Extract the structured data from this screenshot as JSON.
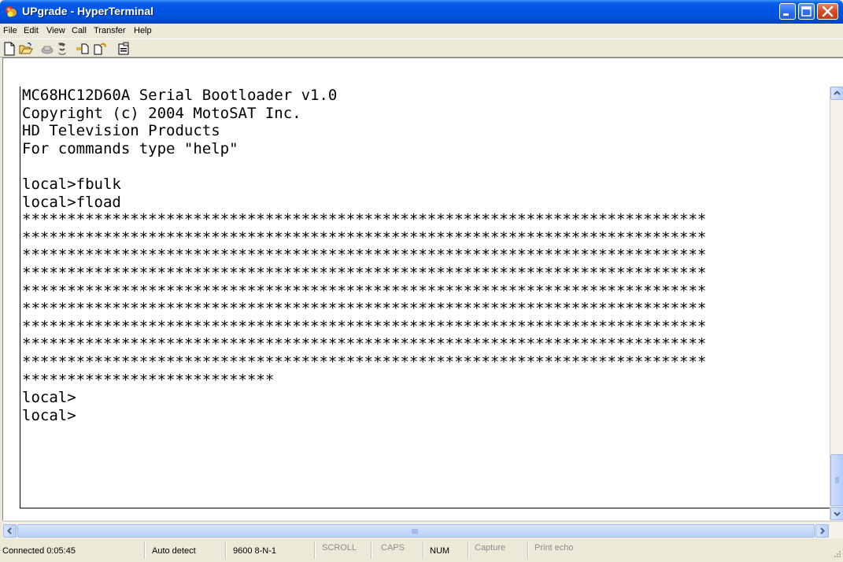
{
  "window": {
    "title": "UPgrade - HyperTerminal"
  },
  "menu": {
    "items": [
      "File",
      "Edit",
      "View",
      "Call",
      "Transfer",
      "Help"
    ]
  },
  "toolbar": {
    "icons": [
      "new-connection-icon",
      "open-icon",
      "disconnect-icon",
      "dial-icon",
      "send-icon",
      "receive-icon",
      "properties-icon"
    ]
  },
  "terminal": {
    "lines": [
      "MC68HC12D60A Serial Bootloader v1.0",
      "Copyright (c) 2004 MotoSAT Inc.",
      "HD Television Products",
      "For commands type \"help\"",
      "",
      "local>fbulk",
      "local>fload",
      "****************************************************************************",
      "****************************************************************************",
      "****************************************************************************",
      "****************************************************************************",
      "****************************************************************************",
      "****************************************************************************",
      "****************************************************************************",
      "****************************************************************************",
      "****************************************************************************",
      "****************************",
      "local>",
      "local>"
    ]
  },
  "statusbar": {
    "connected": "Connected 0:05:45",
    "detect": "Auto detect",
    "settings": "9600 8-N-1",
    "scroll": "SCROLL",
    "caps": "CAPS",
    "num": "NUM",
    "capture": "Capture",
    "print_echo": "Print echo"
  }
}
